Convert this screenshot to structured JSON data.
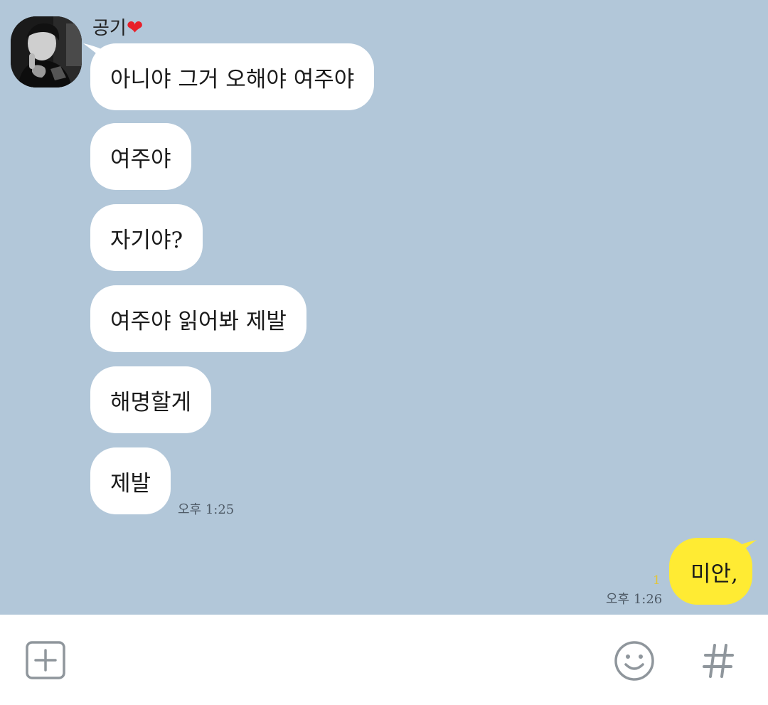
{
  "chat": {
    "sender": {
      "name": "공기",
      "heart": "❤"
    },
    "messages": [
      {
        "text": "아니야 그거 오해야 여주야"
      },
      {
        "text": "여주야"
      },
      {
        "text": "자기야?"
      },
      {
        "text": "여주야 읽어봐 제발"
      },
      {
        "text": "해명할게"
      },
      {
        "text": "제발"
      }
    ],
    "received_time": "오후 1:25",
    "my_message": {
      "text": "미안,",
      "unread_count": "1",
      "time": "오후 1:26"
    }
  },
  "input_bar": {
    "icons": [
      "plus-square-icon",
      "smiley-icon",
      "hashtag-icon"
    ]
  },
  "colors": {
    "chat_background": "#b2c7d9",
    "received_bubble": "#ffffff",
    "sent_bubble": "#ffeb33",
    "unread_count": "#e2c53a",
    "icon_gray": "#9aa0a6"
  }
}
